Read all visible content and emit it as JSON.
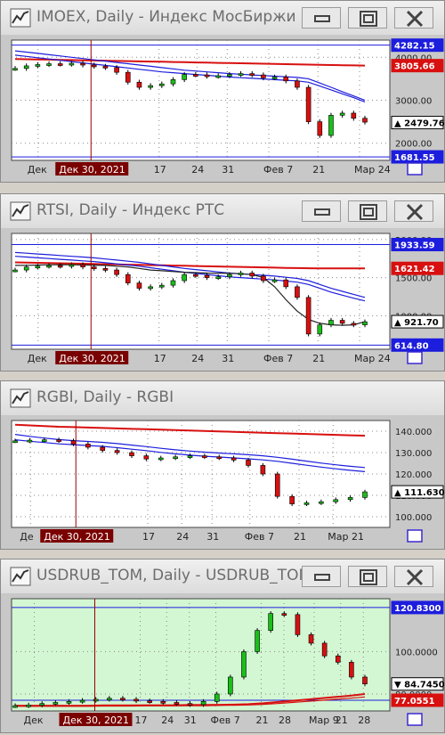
{
  "windows": [
    {
      "title": "IMOEX, Daily - Индекс МосБиржи"
    },
    {
      "title": "RTSI, Daily - Индекс РТС"
    },
    {
      "title": "RGBI, Daily - RGBI"
    },
    {
      "title": "USDRUB_TOM, Daily - USDRUB_TOM"
    }
  ],
  "controls": {
    "minimize": "minimize-button",
    "maximize": "maximize-button",
    "close": "close-button"
  },
  "chart_data": [
    {
      "type": "candlestick",
      "instrument": "IMOEX",
      "ylim": [
        1600,
        4400
      ],
      "y_ticks": [
        2000,
        3000,
        4000
      ],
      "y_tick_labels": [
        "2000.00",
        "3000.00",
        "4000.00"
      ],
      "x_ticks": [
        "Дек 30, 2021",
        "17",
        "24",
        "31",
        "Фев 7",
        "21",
        "Мар 24"
      ],
      "x_tick_labels": [
        "Дек",
        "17",
        "24",
        "31",
        "Фев 7",
        "21",
        "Мар 24"
      ],
      "cursor_label": "Дек 30, 2021",
      "value_labels": [
        {
          "value": 4282.15,
          "text": "4282.15",
          "bg": "#1d1ddd",
          "fg": "#ffffff"
        },
        {
          "value": 3805.66,
          "text": "3805.66",
          "bg": "#d81010",
          "fg": "#ffffff"
        },
        {
          "value": 2479.76,
          "text": "2479.76",
          "bg": "#ffffff",
          "fg": "#000000",
          "marker": "▲"
        },
        {
          "value": 1681.55,
          "text": "1681.55",
          "bg": "#1d1ddd",
          "fg": "#ffffff"
        }
      ],
      "hlines": [
        4282.15,
        1681.55
      ],
      "series": [
        {
          "name": "",
          "color": "#d81010",
          "values": [
            3960,
            3955,
            3950,
            3945,
            3940,
            3935,
            3930,
            3925,
            3920,
            3915,
            3910,
            3905,
            3900,
            3895,
            3890,
            3885,
            3880,
            3875,
            3870,
            3865,
            3860,
            3855,
            3850,
            3845,
            3840,
            3835,
            3830,
            3825,
            3820,
            3815,
            3810,
            3806
          ]
        },
        {
          "name": "",
          "color": "#1d1ddd",
          "values": [
            4150,
            4120,
            4090,
            4060,
            4030,
            4000,
            3970,
            3940,
            3910,
            3880,
            3850,
            3820,
            3790,
            3760,
            3730,
            3700,
            3680,
            3660,
            3640,
            3620,
            3605,
            3590,
            3575,
            3560,
            3545,
            3530,
            3500,
            3400,
            3300,
            3200,
            3100,
            3000
          ]
        },
        {
          "name": "",
          "color": "#1d1ddd",
          "values": [
            4050,
            4020,
            3990,
            3960,
            3930,
            3900,
            3870,
            3840,
            3810,
            3780,
            3750,
            3720,
            3690,
            3660,
            3640,
            3620,
            3600,
            3580,
            3560,
            3540,
            3525,
            3510,
            3495,
            3480,
            3465,
            3450,
            3420,
            3330,
            3240,
            3150,
            3060,
            2960
          ]
        }
      ],
      "candles": [
        3740,
        3800,
        3830,
        3850,
        3840,
        3860,
        3820,
        3790,
        3760,
        3650,
        3420,
        3300,
        3340,
        3380,
        3480,
        3600,
        3590,
        3560,
        3570,
        3600,
        3620,
        3590,
        3520,
        3540,
        3450,
        3300,
        2500,
        2180,
        2650,
        2700,
        2580,
        2490
      ]
    },
    {
      "type": "candlestick",
      "instrument": "RTSI",
      "ylim": [
        560,
        2080
      ],
      "y_ticks": [
        1000,
        1500,
        2000
      ],
      "y_tick_labels": [
        "1000.00",
        "1500.00",
        "2000.00"
      ],
      "x_ticks": [
        "Дек 30, 2021",
        "17",
        "24",
        "31",
        "Фев 7",
        "21",
        "Мар 24"
      ],
      "x_tick_labels": [
        "Дек",
        "17",
        "24",
        "31",
        "Фев 7",
        "21",
        "Мар 24"
      ],
      "cursor_label": "Дек 30, 2021",
      "value_labels": [
        {
          "value": 1933.59,
          "text": "1933.59",
          "bg": "#1d1ddd",
          "fg": "#ffffff"
        },
        {
          "value": 1621.42,
          "text": "1621.42",
          "bg": "#d81010",
          "fg": "#ffffff"
        },
        {
          "value": 921.7,
          "text": "921.70",
          "bg": "#ffffff",
          "fg": "#000000",
          "marker": "▲"
        },
        {
          "value": 614.8,
          "text": "614.80",
          "bg": "#1d1ddd",
          "fg": "#ffffff"
        }
      ],
      "hlines": [
        1933.59,
        614.8
      ],
      "series": [
        {
          "name": "",
          "color": "#d81010",
          "values": [
            1700,
            1697,
            1694,
            1691,
            1688,
            1685,
            1682,
            1679,
            1676,
            1673,
            1670,
            1667,
            1664,
            1661,
            1658,
            1655,
            1652,
            1649,
            1646,
            1643,
            1640,
            1637,
            1634,
            1631,
            1628,
            1625,
            1623,
            1622,
            1621,
            1621,
            1621,
            1621
          ]
        },
        {
          "name": "",
          "color": "#1d1ddd",
          "values": [
            1830,
            1820,
            1810,
            1800,
            1790,
            1780,
            1770,
            1760,
            1745,
            1730,
            1715,
            1700,
            1680,
            1660,
            1640,
            1620,
            1605,
            1590,
            1575,
            1560,
            1550,
            1540,
            1530,
            1520,
            1505,
            1490,
            1460,
            1410,
            1360,
            1320,
            1280,
            1240
          ]
        },
        {
          "name": "",
          "color": "#1d1ddd",
          "values": [
            1780,
            1770,
            1760,
            1750,
            1740,
            1730,
            1720,
            1710,
            1695,
            1680,
            1665,
            1650,
            1630,
            1610,
            1590,
            1570,
            1555,
            1540,
            1525,
            1510,
            1500,
            1490,
            1480,
            1470,
            1455,
            1440,
            1410,
            1360,
            1310,
            1270,
            1230,
            1195
          ]
        },
        {
          "name": "",
          "color": "#222222",
          "values": [
            1660,
            1662,
            1665,
            1668,
            1670,
            1668,
            1666,
            1664,
            1660,
            1650,
            1640,
            1620,
            1600,
            1590,
            1580,
            1570,
            1565,
            1560,
            1558,
            1556,
            1550,
            1540,
            1500,
            1380,
            1210,
            1060,
            950,
            900,
            880,
            875,
            880,
            921
          ]
        }
      ],
      "candles": [
        1600,
        1640,
        1650,
        1660,
        1650,
        1670,
        1640,
        1620,
        1600,
        1540,
        1430,
        1360,
        1380,
        1400,
        1460,
        1540,
        1530,
        1500,
        1510,
        1540,
        1560,
        1520,
        1460,
        1470,
        1380,
        1240,
        760,
        880,
        940,
        900,
        880,
        920
      ]
    },
    {
      "type": "candlestick",
      "instrument": "RGBI",
      "ylim": [
        95,
        145
      ],
      "y_ticks": [
        100,
        110,
        120,
        130,
        140
      ],
      "y_tick_labels": [
        "100.000",
        "110.000",
        "120.000",
        "130.000",
        "140.000"
      ],
      "x_ticks": [
        "Дек 30, 2021",
        "17",
        "24",
        "31",
        "Фев 7",
        "21",
        "Мар 21"
      ],
      "x_tick_labels": [
        "Де",
        "17",
        "24",
        "31",
        "Фев 7",
        "21",
        "Мар 21"
      ],
      "cursor_label": "Дек 30, 2021",
      "value_labels": [
        {
          "value": 111.63,
          "text": "111.6300",
          "bg": "#ffffff",
          "fg": "#000000",
          "marker": "▲"
        }
      ],
      "hlines": [],
      "series": [
        {
          "name": "",
          "color": "#d81010",
          "values": [
            143.0,
            142.7,
            142.4,
            142.1,
            141.9,
            141.7,
            141.5,
            141.3,
            141.1,
            140.9,
            140.7,
            140.5,
            140.3,
            140.1,
            139.9,
            139.7,
            139.5,
            139.3,
            139.1,
            138.9,
            138.7,
            138.5,
            138.3,
            138.1,
            137.9
          ]
        },
        {
          "name": "",
          "color": "#1d1ddd",
          "values": [
            138.5,
            137.6,
            136.8,
            136.1,
            135.6,
            135.2,
            134.8,
            134.2,
            133.5,
            132.8,
            132.0,
            131.3,
            130.7,
            130.2,
            129.8,
            129.4,
            129.0,
            128.5,
            127.8,
            126.9,
            126.0,
            125.1,
            124.3,
            123.6,
            123.0
          ]
        },
        {
          "name": "",
          "color": "#1d1ddd",
          "values": [
            136.0,
            135.3,
            134.7,
            134.1,
            133.7,
            133.3,
            132.9,
            132.3,
            131.6,
            130.9,
            130.1,
            129.4,
            128.8,
            128.3,
            127.9,
            127.5,
            127.1,
            126.6,
            125.9,
            125.0,
            124.1,
            123.2,
            122.4,
            121.7,
            121.1
          ]
        }
      ],
      "candles": [
        135.5,
        135.8,
        136.0,
        135.5,
        134.0,
        132.5,
        131.0,
        130.0,
        128.5,
        127.0,
        127.5,
        128.0,
        128.5,
        128.0,
        127.5,
        126.5,
        124.0,
        120.0,
        109.5,
        106.0,
        106.5,
        107.0,
        108.0,
        109.0,
        111.63
      ]
    },
    {
      "type": "candlestick",
      "instrument": "USDRUB_TOM",
      "ylim": [
        72,
        125
      ],
      "y_ticks": [
        80,
        100
      ],
      "y_tick_labels": [
        "80.0000",
        "100.0000"
      ],
      "x_ticks": [
        "Дек 30, 2021",
        "17",
        "24",
        "31",
        "Фев 7",
        "21",
        "28",
        "Мар 9",
        "21",
        "28"
      ],
      "x_tick_labels": [
        "Дек",
        "17",
        "24",
        "31",
        "Фев 7",
        "21",
        "28",
        "Мар 9",
        "21",
        "28"
      ],
      "cursor_label": "Дек 30, 2021",
      "value_labels": [
        {
          "value": 120.83,
          "text": "120.8300",
          "bg": "#1d1ddd",
          "fg": "#ffffff"
        },
        {
          "value": 84.745,
          "text": "84.7450",
          "bg": "#ffffff",
          "fg": "#000000",
          "marker": "▼"
        },
        {
          "value": 77.0551,
          "text": "77.0551",
          "bg": "#d81010",
          "fg": "#ffffff"
        }
      ],
      "hlines": [
        120.83,
        77.0551
      ],
      "series": [
        {
          "name": "",
          "color": "#d81010",
          "values": [
            74.5,
            74.5,
            74.5,
            74.5,
            74.5,
            74.5,
            74.6,
            74.6,
            74.6,
            74.7,
            74.7,
            74.7,
            74.8,
            74.8,
            74.9,
            75.0,
            75.2,
            75.6,
            76.2,
            76.8,
            77.4,
            78.0,
            78.6,
            79.2,
            80.0
          ]
        },
        {
          "name": "",
          "color": "#d81010",
          "values": [
            74.2,
            74.2,
            74.2,
            74.2,
            74.2,
            74.2,
            74.3,
            74.3,
            74.3,
            74.4,
            74.4,
            74.4,
            74.5,
            74.5,
            74.6,
            74.7,
            74.8,
            75.1,
            75.5,
            76.0,
            76.5,
            77.0,
            77.5,
            78.0,
            78.6
          ]
        }
      ],
      "candles": [
        74.5,
        74.8,
        75.5,
        76.0,
        76.5,
        77.0,
        77.5,
        78.0,
        77.5,
        76.8,
        76.5,
        76.0,
        75.5,
        75.0,
        76.5,
        80.0,
        88.0,
        100.0,
        110.0,
        118.0,
        117.5,
        108.0,
        104.0,
        98.0,
        95.0,
        88.0,
        84.745
      ]
    }
  ]
}
